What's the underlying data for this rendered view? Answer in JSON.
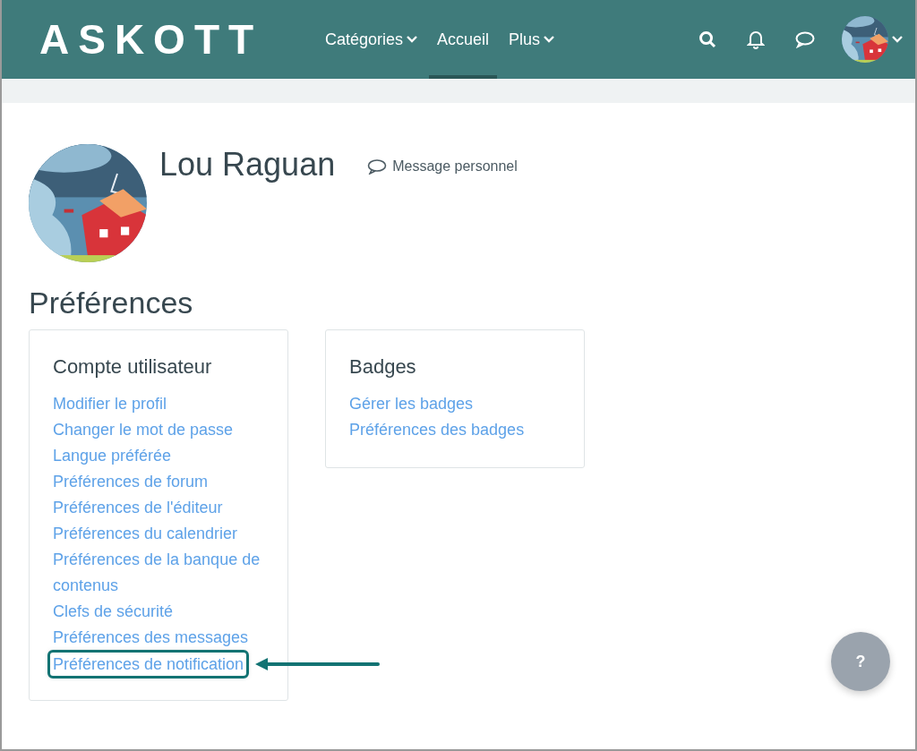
{
  "header": {
    "logo": "ASKOTT",
    "nav": [
      {
        "label": "Catégories",
        "dropdown": true,
        "selected": false
      },
      {
        "label": "Accueil",
        "dropdown": false,
        "selected": true
      },
      {
        "label": "Plus",
        "dropdown": true,
        "selected": false
      }
    ]
  },
  "profile": {
    "name": "Lou Raguan",
    "message_link": "Message personnel"
  },
  "title": "Préférences",
  "cards": [
    {
      "heading": "Compte utilisateur",
      "links": [
        {
          "label": "Modifier le profil",
          "highlighted": false
        },
        {
          "label": "Changer le mot de passe",
          "highlighted": false
        },
        {
          "label": "Langue préférée",
          "highlighted": false
        },
        {
          "label": "Préférences de forum",
          "highlighted": false
        },
        {
          "label": "Préférences de l'éditeur",
          "highlighted": false
        },
        {
          "label": "Préférences du calendrier",
          "highlighted": false
        },
        {
          "label": "Préférences de la banque de contenus",
          "highlighted": false
        },
        {
          "label": "Clefs de sécurité",
          "highlighted": false
        },
        {
          "label": "Préférences des messages",
          "highlighted": false
        },
        {
          "label": "Préférences de notification",
          "highlighted": true
        }
      ]
    },
    {
      "heading": "Badges",
      "links": [
        {
          "label": "Gérer les badges",
          "highlighted": false
        },
        {
          "label": "Préférences des badges",
          "highlighted": false
        }
      ]
    }
  ],
  "help_button": "?"
}
